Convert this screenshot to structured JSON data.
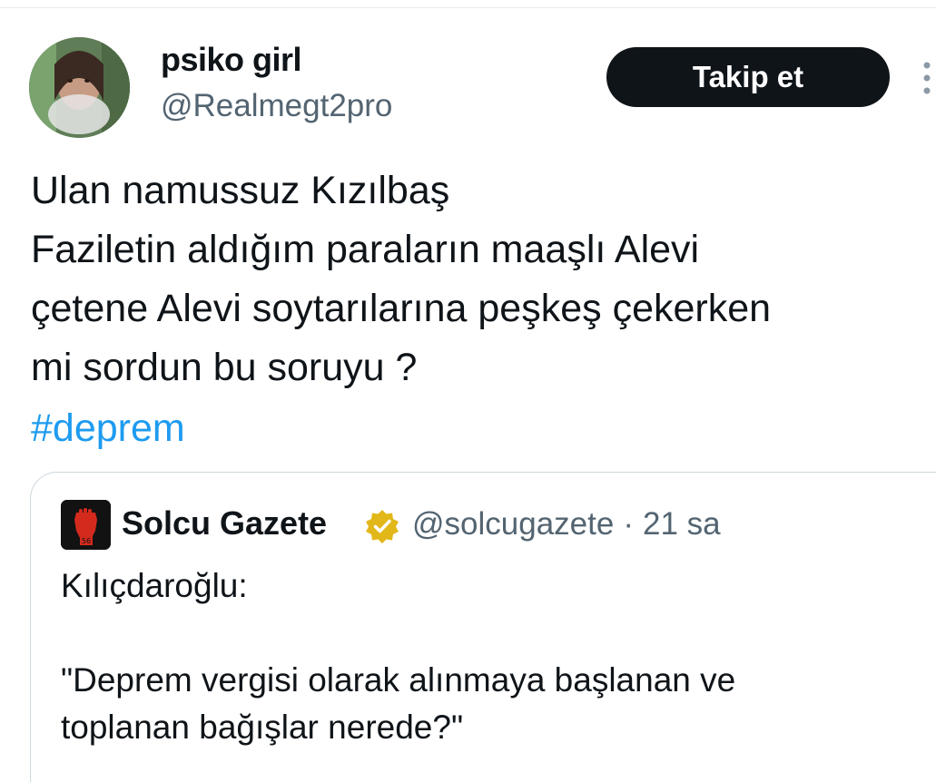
{
  "tweet": {
    "author_name": "psiko girl",
    "author_handle": "@Realmegt2pro",
    "follow_label": "Takip et",
    "text_lines": [
      "Ulan namussuz Kızılbaş",
      "Faziletin aldığım paraların maaşlı Alevi",
      "çetene Alevi soytarılarına peşkeş çekerken",
      "mi sordun bu soruyu ?"
    ],
    "hashtag": "#deprem",
    "colors": {
      "text": "#0f1419",
      "secondary": "#536471",
      "link": "#1d9bf0",
      "button_bg": "#0f1419",
      "verified": "#e2b719"
    },
    "icons": {
      "more": "more-vertical-icon",
      "verified": "verified-badge-icon"
    }
  },
  "quoted": {
    "name": "Solcu Gazete",
    "handle": "@solcugazete",
    "separator": "·",
    "time": "21 sa",
    "paragraph_1": "Kılıçdaroğlu:",
    "paragraph_2_lines": [
      "\"Deprem vergisi olarak alınmaya başlanan ve",
      "toplanan bağışlar nerede?\""
    ],
    "logo_text": "56"
  }
}
